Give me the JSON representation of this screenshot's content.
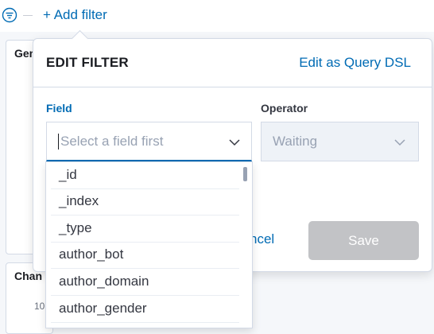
{
  "topbar": {
    "filter_icon": "filter-icon",
    "add_filter_label": "+ Add filter"
  },
  "background": {
    "panel1_title": "Gen",
    "panel2_title": "Chan",
    "panel2_tick": "10"
  },
  "edit_filter": {
    "title": "EDIT FILTER",
    "query_dsl_link": "Edit as Query DSL",
    "field_label": "Field",
    "field_placeholder": "Select a field first",
    "operator_label": "Operator",
    "operator_value": "Waiting",
    "cancel_label": "ncel",
    "save_label": "Save"
  },
  "field_options": [
    "_id",
    "_index",
    "_type",
    "author_bot",
    "author_domain",
    "author_gender"
  ],
  "colors": {
    "accent": "#006bb4",
    "save_disabled": "#c2c3c6"
  }
}
